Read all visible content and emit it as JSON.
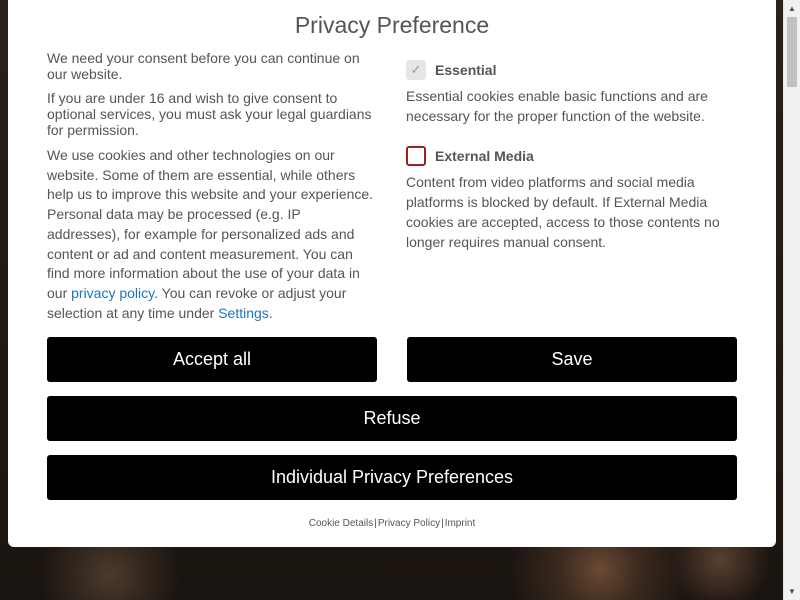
{
  "dialog": {
    "title": "Privacy Preference",
    "intro": [
      "We need your consent before you can continue on our website.",
      "If you are under 16 and wish to give consent to optional services, you must ask your legal guardians for permission."
    ],
    "cookie_text_before_link": "We use cookies and other technologies on our website. Some of them are essential, while others help us to improve this website and your experience. Personal data may be processed (e.g. IP addresses), for example for personalized ads and content or ad and content measurement. You can find more information about the use of your data in our ",
    "privacy_link": "privacy policy",
    "cookie_text_middle": ". You can revoke or adjust your selection at any time under ",
    "settings_link": "Settings",
    "cookie_text_end": ".",
    "groups": [
      {
        "label": "Essential",
        "checked": true,
        "description": "Essential cookies enable basic functions and are necessary for the proper function of the website."
      },
      {
        "label": "External Media",
        "checked": false,
        "description": "Content from video platforms and social media platforms is blocked by default. If External Media cookies are accepted, access to those contents no longer requires manual consent."
      }
    ],
    "buttons": {
      "accept_all": "Accept all",
      "save": "Save",
      "refuse": "Refuse",
      "individual": "Individual Privacy Preferences"
    },
    "footer": {
      "cookie_details": "Cookie Details",
      "privacy_policy": "Privacy Policy",
      "imprint": "Imprint",
      "separator": "|"
    }
  },
  "icons": {
    "checkmark": "✓",
    "scroll_up": "▲",
    "scroll_down": "▼"
  },
  "colors": {
    "button_bg": "#000000",
    "button_text": "#ffffff",
    "link": "#1e73be",
    "unchecked_border": "#9b2020"
  }
}
